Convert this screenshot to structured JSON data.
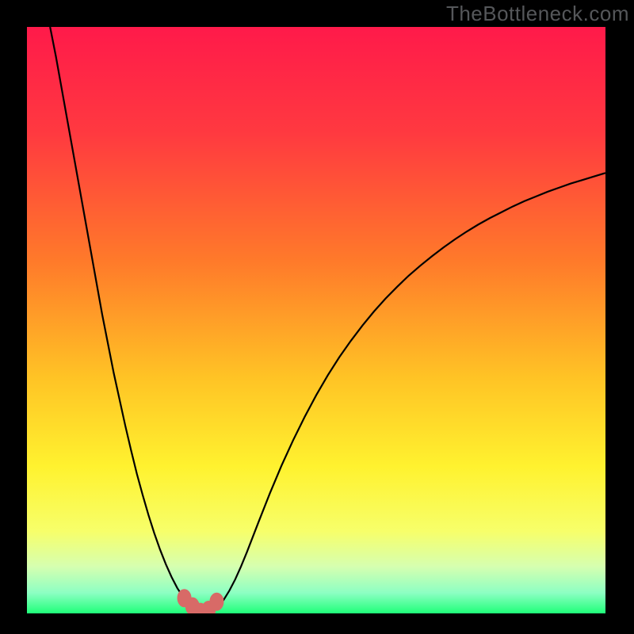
{
  "watermark": "TheBottleneck.com",
  "colors": {
    "frame": "#000000",
    "gradient_stops": [
      {
        "offset": 0.0,
        "color": "#ff1a4a"
      },
      {
        "offset": 0.18,
        "color": "#ff3940"
      },
      {
        "offset": 0.4,
        "color": "#ff7a2a"
      },
      {
        "offset": 0.6,
        "color": "#ffc425"
      },
      {
        "offset": 0.75,
        "color": "#fff22f"
      },
      {
        "offset": 0.86,
        "color": "#f7ff6a"
      },
      {
        "offset": 0.92,
        "color": "#d6ffb0"
      },
      {
        "offset": 0.965,
        "color": "#8dffc3"
      },
      {
        "offset": 1.0,
        "color": "#1fff79"
      }
    ],
    "curve": "#000000",
    "marker_fill": "#d86a67",
    "marker_stroke": "#d86a67"
  },
  "chart_data": {
    "type": "line",
    "title": "",
    "xlabel": "",
    "ylabel": "",
    "xlim": [
      0,
      100
    ],
    "ylim": [
      0,
      100
    ],
    "x": [
      4,
      5,
      6,
      7,
      8,
      9,
      10,
      11,
      12,
      13,
      14,
      15,
      16,
      17,
      18,
      19,
      20,
      21,
      22,
      23,
      24,
      25,
      26,
      27,
      28,
      29,
      30,
      31,
      32,
      33,
      34,
      35,
      36,
      37,
      38,
      40,
      42,
      44,
      46,
      48,
      50,
      52,
      54,
      56,
      58,
      60,
      62,
      64,
      66,
      68,
      70,
      72,
      74,
      76,
      78,
      80,
      82,
      84,
      86,
      88,
      90,
      92,
      94,
      96,
      98,
      100
    ],
    "y": [
      100,
      95,
      89.5,
      84,
      78.5,
      73,
      67.5,
      62,
      56.5,
      51,
      46,
      41,
      36.5,
      32,
      27.8,
      23.8,
      20.2,
      16.8,
      13.7,
      10.9,
      8.4,
      6.2,
      4.3,
      2.8,
      1.6,
      0.8,
      0.3,
      0.2,
      0.4,
      1.1,
      2.3,
      3.9,
      5.8,
      8.0,
      10.4,
      15.5,
      20.5,
      25.2,
      29.5,
      33.5,
      37.2,
      40.6,
      43.7,
      46.5,
      49.1,
      51.5,
      53.7,
      55.7,
      57.6,
      59.3,
      60.9,
      62.4,
      63.8,
      65.1,
      66.3,
      67.4,
      68.4,
      69.4,
      70.3,
      71.1,
      71.9,
      72.6,
      73.3,
      73.9,
      74.5,
      75.1
    ],
    "markers_x": [
      27.2,
      28.6,
      30.0,
      31.4,
      32.8
    ],
    "markers_y": [
      2.6,
      1.2,
      0.25,
      0.6,
      2.0
    ]
  }
}
